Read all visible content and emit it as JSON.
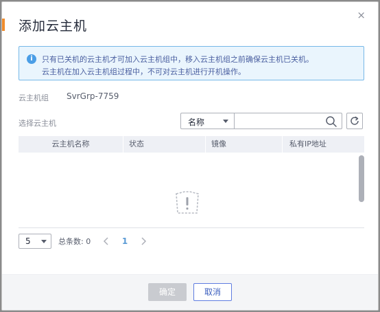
{
  "dialog": {
    "title": "添加云主机",
    "close_glyph": "×",
    "notice": {
      "icon": "info-icon",
      "icon_glyph": "i",
      "line1": "只有已关机的云主机才可加入云主机组中，移入云主机组之前确保云主机已关机。",
      "line2": "云主机在加入云主机组过程中，不可对云主机进行开机操作。"
    },
    "group": {
      "label": "云主机组",
      "value": "SvrGrp-7759"
    },
    "choose": {
      "label": "选择云主机",
      "filter_field": "名称",
      "search_value": "",
      "search_placeholder": ""
    },
    "table": {
      "columns": [
        "云主机名称",
        "状态",
        "镜像",
        "私有IP地址"
      ],
      "rows": [],
      "empty_icon": "empty-state-icon"
    },
    "pagination": {
      "page_size": "5",
      "total_text": "总条数: 0",
      "current_page": "1"
    },
    "footer": {
      "ok_label": "确定",
      "cancel_label": "取消"
    }
  },
  "colors": {
    "accent": "#f08c2d",
    "notice_bg": "#eaf5fd",
    "notice_border": "#76b8e8",
    "primary": "#5e7ce0",
    "disabled_button": "#c9cbd0"
  }
}
